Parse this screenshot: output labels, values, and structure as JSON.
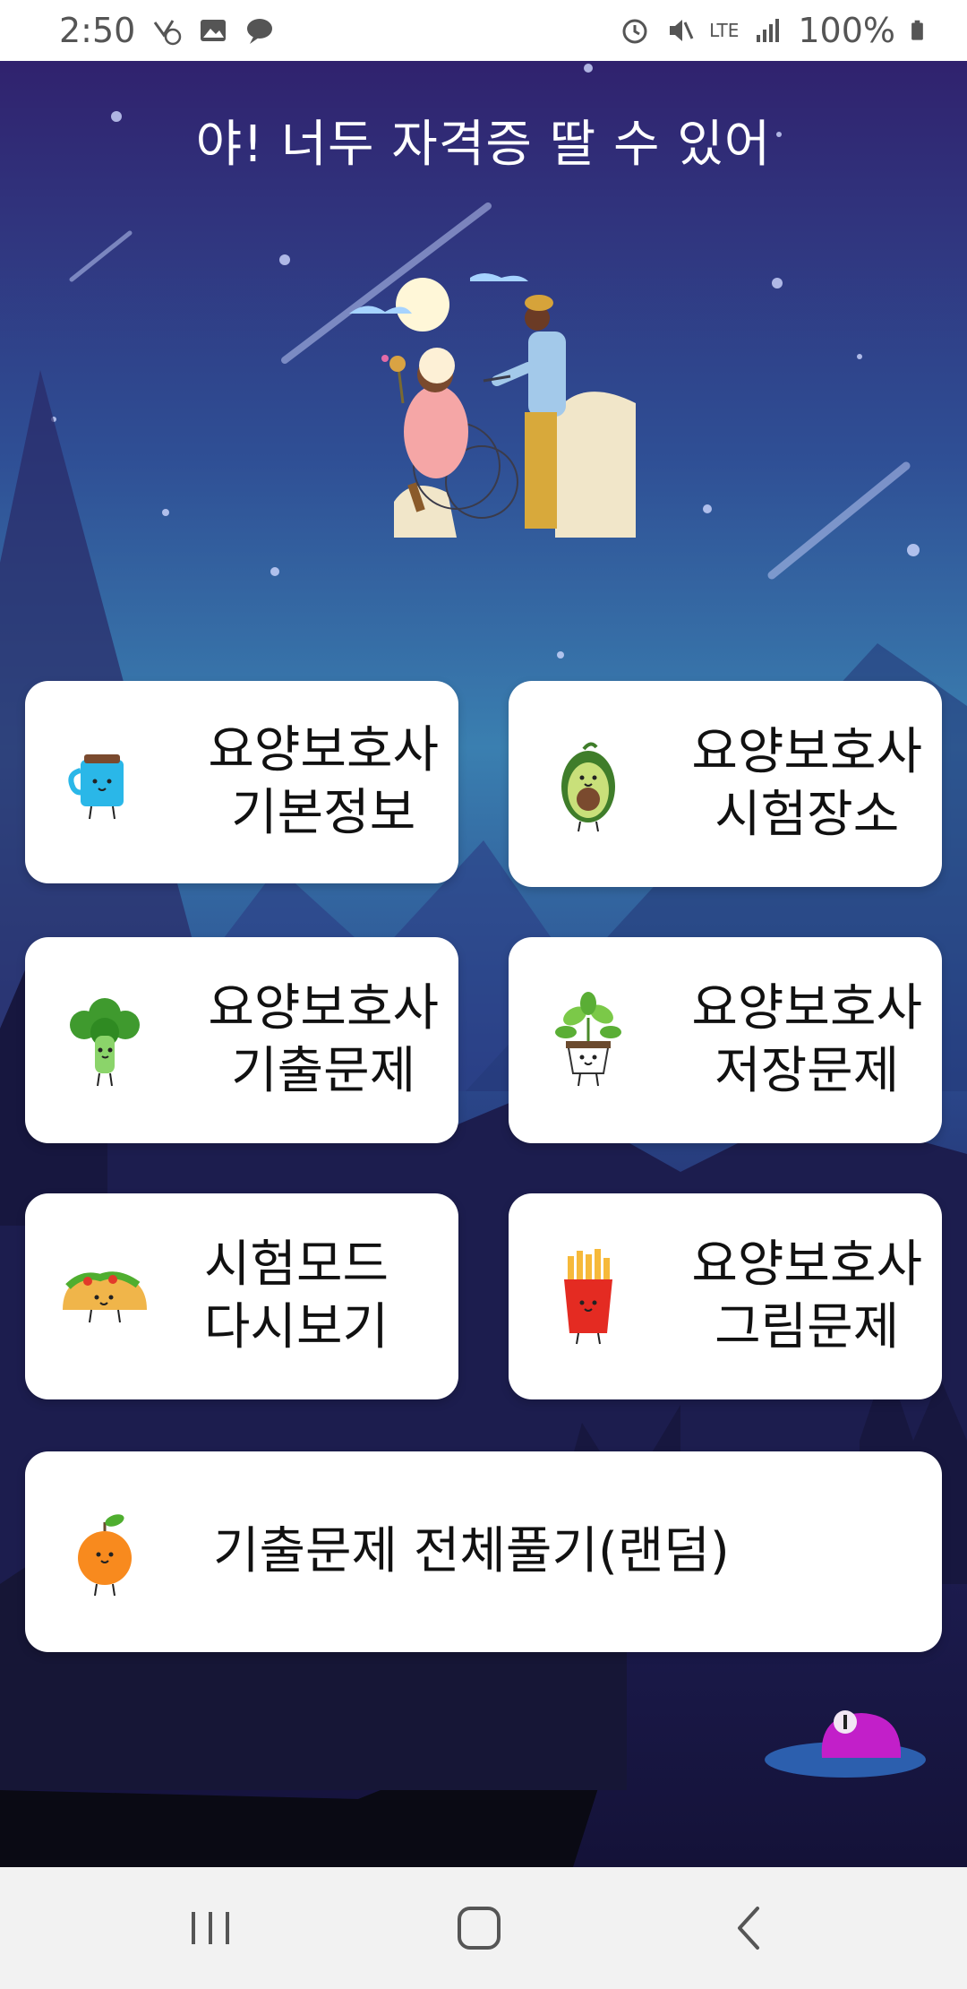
{
  "status_bar": {
    "time": "2:50",
    "network": "LTE",
    "battery": "100%",
    "icons_left": [
      "missed-call-icon",
      "image-icon",
      "chat-bubble-icon"
    ],
    "icons_right": [
      "alarm-icon",
      "vibrate-mute-icon",
      "signal-icon",
      "battery-icon"
    ]
  },
  "header": {
    "title": "야! 너두 자격증 딸 수 있어"
  },
  "menu": [
    {
      "label": "요양보호사\n기본정보",
      "icon": "mug-icon"
    },
    {
      "label": "요양보호사\n시험장소",
      "icon": "avocado-icon"
    },
    {
      "label": "요양보호사\n기출문제",
      "icon": "broccoli-icon"
    },
    {
      "label": "요양보호사\n저장문제",
      "icon": "potted-plant-icon"
    },
    {
      "label": "시험모드\n다시보기",
      "icon": "taco-icon"
    },
    {
      "label": "요양보호사\n그림문제",
      "icon": "fries-icon"
    },
    {
      "label": "기출문제 전체풀기(랜덤)",
      "icon": "orange-icon"
    }
  ],
  "nav": {
    "buttons": [
      "recent-apps",
      "home",
      "back"
    ]
  },
  "colors": {
    "card_bg": "#ffffff",
    "text": "#111111",
    "accent_creature": "#c21fc9"
  }
}
